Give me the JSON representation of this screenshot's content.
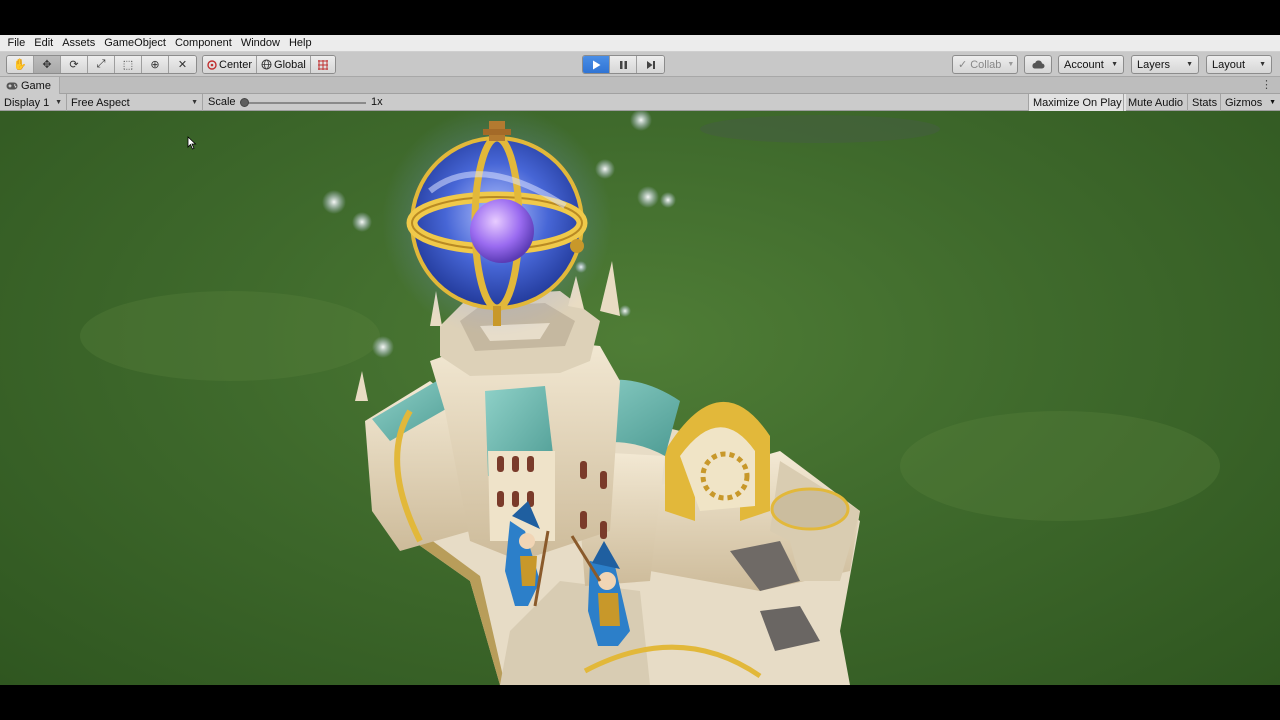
{
  "menu": [
    "File",
    "Edit",
    "Assets",
    "GameObject",
    "Component",
    "Window",
    "Help"
  ],
  "toolbar": {
    "tools": [
      {
        "name": "hand-tool-button",
        "icon": "hand-icon",
        "glyph": "✋"
      },
      {
        "name": "move-tool-button",
        "icon": "move-icon",
        "glyph": "✥"
      },
      {
        "name": "rotate-tool-button",
        "icon": "rotate-icon",
        "glyph": "⟳"
      },
      {
        "name": "scale-tool-button",
        "icon": "scale-icon",
        "glyph": "⤢"
      },
      {
        "name": "rect-tool-button",
        "icon": "rect-icon",
        "glyph": "⬚"
      },
      {
        "name": "transform-tool-button",
        "icon": "transform-icon",
        "glyph": "⊕"
      },
      {
        "name": "custom-tool-button",
        "icon": "tools-icon",
        "glyph": "✕"
      }
    ],
    "pivot_label": "Center",
    "space_label": "Global",
    "snap_icon": "grid-snap-icon",
    "collab_label": "Collab",
    "account_label": "Account",
    "layers_label": "Layers",
    "layout_label": "Layout"
  },
  "tab": {
    "label": "Game"
  },
  "gamebar": {
    "display": "Display 1",
    "aspect": "Free Aspect",
    "scale_label": "Scale",
    "scale_value": "1x",
    "buttons": [
      "Maximize On Play",
      "Mute Audio",
      "Stats",
      "Gizmos"
    ]
  },
  "colors": {
    "play_active": "#3a7ee0",
    "grass": "#3f6a2c",
    "orb_blue": "#3a5fd0",
    "gold": "#e2b83a",
    "stone": "#e9dcc3",
    "teal_roof": "#69b5ad",
    "wizard_blue": "#2c7fc9"
  }
}
